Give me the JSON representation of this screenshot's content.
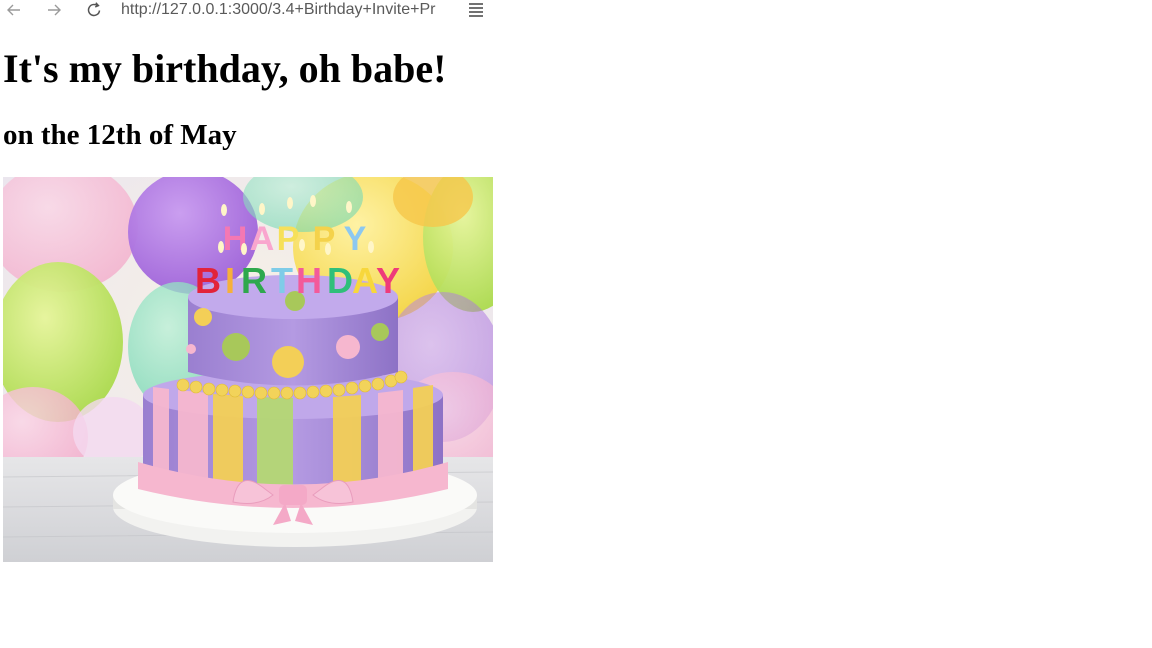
{
  "browser": {
    "url": "http://127.0.0.1:3000/3.4+Birthday+Invite+Pr",
    "back_icon": "arrow-left-icon",
    "forward_icon": "arrow-right-icon",
    "reload_icon": "reload-icon",
    "menu_icon": "reader-menu-icon"
  },
  "page": {
    "heading": "It's my birthday, oh babe!",
    "subheading": "on the 12th of May"
  },
  "image": {
    "subject": "birthday-cake-photo",
    "topper_line1": "HAPPY",
    "topper_line2": "BIRTHDAY",
    "colors": {
      "cake_lavender": "#a98fd8",
      "ribbon_pink": "#f6b7cf",
      "stripe_yellow": "#f3cf57",
      "stripe_green": "#b5d874",
      "plate_white": "#f2f2f0"
    }
  }
}
